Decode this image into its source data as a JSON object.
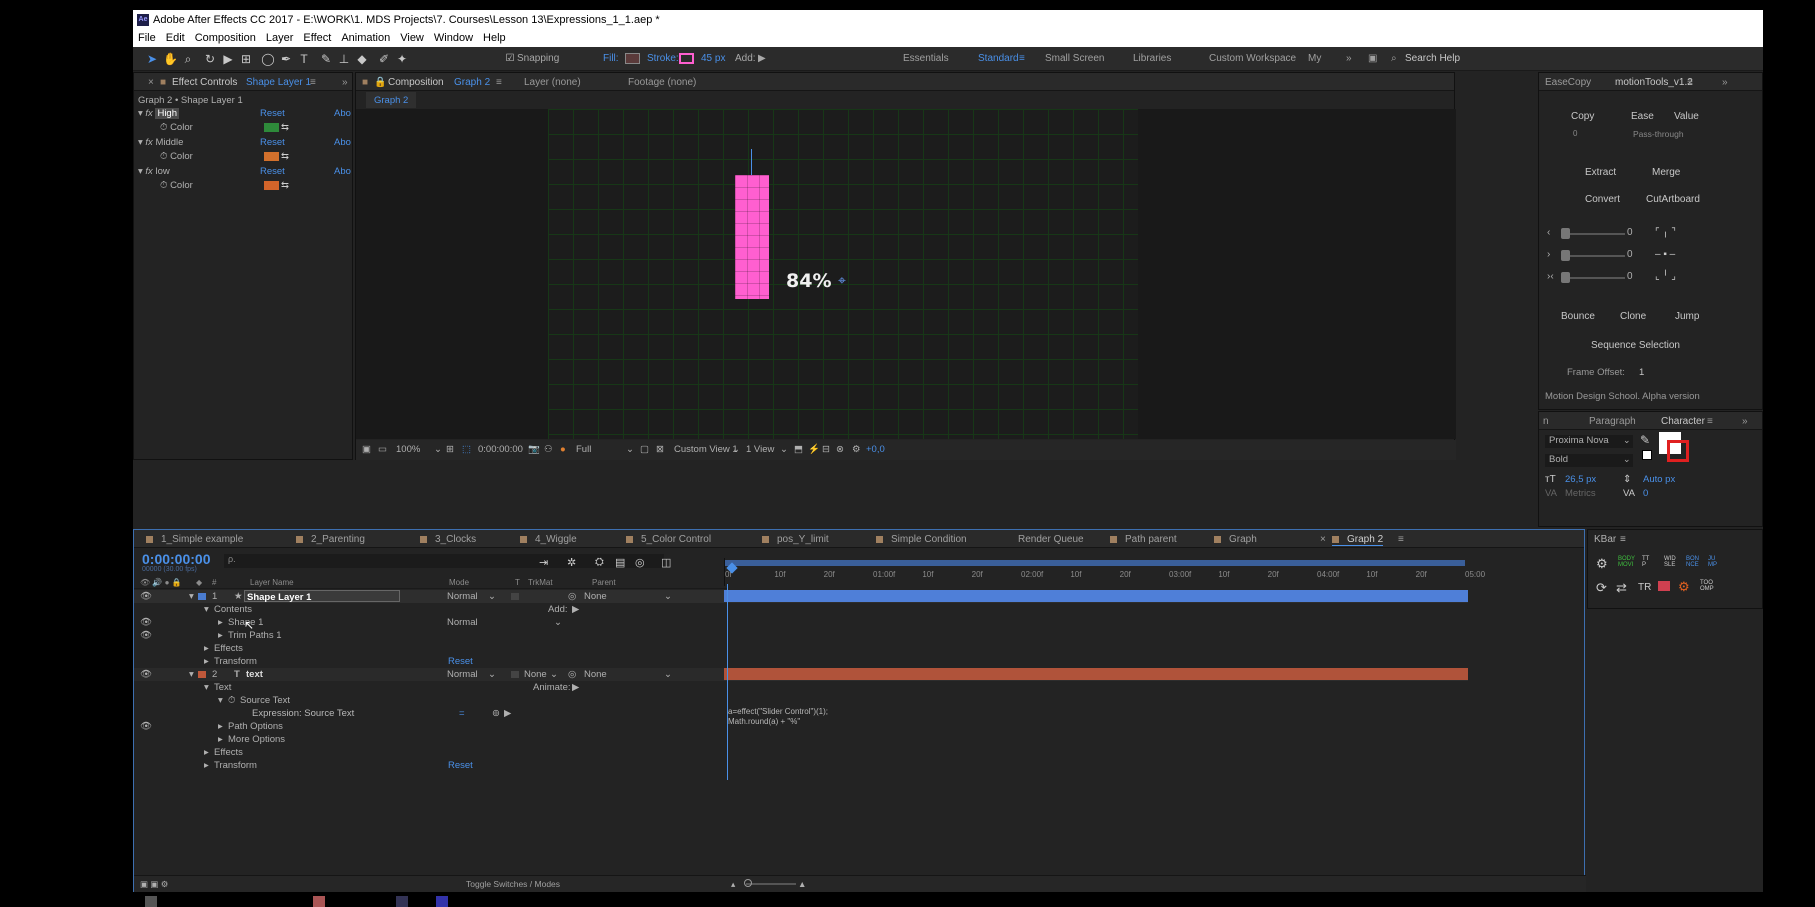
{
  "window": {
    "title": "Adobe After Effects CC 2017 - E:\\WORK\\1. MDS Projects\\7. Courses\\Lesson 13\\Expressions_1_1.aep *",
    "icon": "Ae"
  },
  "menu": [
    "File",
    "Edit",
    "Composition",
    "Layer",
    "Effect",
    "Animation",
    "View",
    "Window",
    "Help"
  ],
  "toolbar": {
    "snapping": "Snapping",
    "fill": "Fill:",
    "stroke": "Stroke:",
    "stroke_width": "45 px",
    "add": "Add:",
    "workspaces": [
      "Essentials",
      "Standard",
      "Small Screen",
      "Libraries",
      "Custom Workspace",
      "My"
    ],
    "search": "Search Help"
  },
  "effect_controls": {
    "tab": "Effect Controls",
    "layer": "Shape Layer 1",
    "path": "Graph 2 • Shape Layer 1",
    "effects": [
      {
        "name": "High",
        "prop": "Color",
        "reset": "Reset",
        "about": "Abo",
        "color": "#2e8a3a"
      },
      {
        "name": "Middle",
        "prop": "Color",
        "reset": "Reset",
        "about": "Abo",
        "color": "#d2702c"
      },
      {
        "name": "low",
        "prop": "Color",
        "reset": "Reset",
        "about": "Abo",
        "color": "#d2642a"
      }
    ]
  },
  "composition": {
    "tab": "Composition",
    "name": "Graph 2",
    "layer_tab": "Layer (none)",
    "footage_tab": "Footage (none)",
    "breadcrumb": "Graph 2",
    "percent_text": "84%",
    "zoom": "100%",
    "time": "0:00:00:00",
    "resolution": "Full",
    "view": "Custom View 1",
    "views": "1 View",
    "exposure": "+0,0",
    "bar_color": "#ff5fd0"
  },
  "motiontools": {
    "tab1": "EaseCopy",
    "tab2": "motionTools_v1.2",
    "copy": "Copy",
    "ease": "Ease",
    "value": "Value",
    "zero": "0",
    "passthrough": "Pass-through",
    "extract": "Extract",
    "merge": "Merge",
    "convert": "Convert",
    "cutartboard": "CutArtboard",
    "slider_values": [
      "0",
      "0",
      "0"
    ],
    "bounce": "Bounce",
    "clone": "Clone",
    "jump": "Jump",
    "sequence": "Sequence Selection",
    "frame_offset_label": "Frame Offset:",
    "frame_offset": "1",
    "footer": "Motion Design School. Alpha version"
  },
  "character": {
    "tab_left": "n",
    "paragraph": "Paragraph",
    "character": "Character",
    "font": "Proxima Nova",
    "style": "Bold",
    "size": "26,5 px",
    "leading": "Auto px",
    "metrics": "Metrics",
    "tracking": "0"
  },
  "timeline": {
    "tabs": [
      "1_Simple example",
      "2_Parenting",
      "3_Clocks",
      "4_Wiggle",
      "5_Color Control",
      "pos_Y_limit",
      "Simple Condition",
      "Render Queue",
      "Path parent",
      "Graph",
      "Graph 2"
    ],
    "active_tab": "Graph 2",
    "timecode": "0:00:00:00",
    "fps": "00000 (30.00 fps)",
    "search_placeholder": "ρ.",
    "col_num": "#",
    "col_name": "Layer Name",
    "col_mode": "Mode",
    "col_t": "T",
    "col_trkmat": "TrkMat",
    "col_parent": "Parent",
    "ruler": [
      "0f",
      "10f",
      "20f",
      "01:00f",
      "10f",
      "20f",
      "02:00f",
      "10f",
      "20f",
      "03:00f",
      "10f",
      "20f",
      "04:00f",
      "10f",
      "20f",
      "05:00"
    ],
    "rows": [
      {
        "indent": 0,
        "num": "1",
        "name": "Shape Layer 1",
        "mode": "Normal",
        "parent": "None",
        "type": "layer1"
      },
      {
        "indent": 1,
        "name": "Contents",
        "extra": "Add:"
      },
      {
        "indent": 2,
        "name": "Shape 1",
        "mode": "Normal"
      },
      {
        "indent": 2,
        "name": "Trim Paths 1"
      },
      {
        "indent": 1,
        "name": "Effects"
      },
      {
        "indent": 1,
        "name": "Transform",
        "reset": "Reset"
      },
      {
        "indent": 0,
        "num": "2",
        "name": "text",
        "mode": "Normal",
        "trkmat": "None",
        "parent": "None",
        "type": "layer2"
      },
      {
        "indent": 1,
        "name": "Text",
        "extra": "Animate:"
      },
      {
        "indent": 2,
        "name": "Source Text"
      },
      {
        "indent": 3,
        "name": "Expression: Source Text"
      },
      {
        "indent": 2,
        "name": "Path Options"
      },
      {
        "indent": 2,
        "name": "More Options"
      },
      {
        "indent": 1,
        "name": "Effects"
      },
      {
        "indent": 1,
        "name": "Transform",
        "reset": "Reset"
      }
    ],
    "expression_line1": "a=effect(\"Slider Control\")(1);",
    "expression_line2": "Math.round(a) + \"%\"",
    "toggle": "Toggle Switches / Modes"
  },
  "kbar": {
    "title": "KBar",
    "tr": "TR"
  }
}
